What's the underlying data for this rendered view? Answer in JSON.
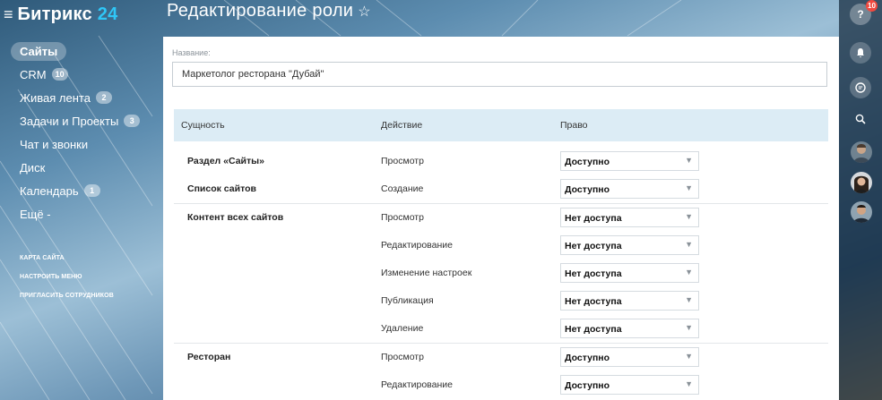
{
  "app": {
    "logo_main": "Битрикс",
    "logo_num": "24"
  },
  "sidebar": {
    "items": [
      {
        "label": "Сайты",
        "badge": ""
      },
      {
        "label": "CRM",
        "badge": "10"
      },
      {
        "label": "Живая лента",
        "badge": "2"
      },
      {
        "label": "Задачи и Проекты",
        "badge": "3"
      },
      {
        "label": "Чат и звонки",
        "badge": ""
      },
      {
        "label": "Диск",
        "badge": ""
      },
      {
        "label": "Календарь",
        "badge": "1"
      },
      {
        "label": "Ещё -",
        "badge": ""
      }
    ],
    "links": [
      "КАРТА САЙТА",
      "НАСТРОИТЬ МЕНЮ",
      "ПРИГЛАСИТЬ СОТРУДНИКОВ"
    ]
  },
  "header": {
    "title": "Редактирование роли",
    "star": "☆"
  },
  "form": {
    "name_label": "Название:",
    "name_value": "Маркетолог ресторана \"Дубай\""
  },
  "table": {
    "headers": {
      "entity": "Сущность",
      "action": "Действие",
      "right": "Право"
    },
    "rows": [
      {
        "entity": "Раздел «Сайты»",
        "action": "Просмотр",
        "right": "Доступно"
      },
      {
        "entity": "Список сайтов",
        "action": "Создание",
        "right": "Доступно"
      },
      {
        "entity": "Контент всех сайтов",
        "action": "Просмотр",
        "right": "Нет доступа"
      },
      {
        "entity": "",
        "action": "Редактирование",
        "right": "Нет доступа"
      },
      {
        "entity": "",
        "action": "Изменение настроек",
        "right": "Нет доступа"
      },
      {
        "entity": "",
        "action": "Публикация",
        "right": "Нет доступа"
      },
      {
        "entity": "",
        "action": "Удаление",
        "right": "Нет доступа"
      },
      {
        "entity": "Ресторан",
        "action": "Просмотр",
        "right": "Доступно"
      },
      {
        "entity": "",
        "action": "Редактирование",
        "right": "Доступно"
      }
    ]
  },
  "rail": {
    "help_label": "?",
    "help_badge": "10",
    "icons": [
      "bell-icon",
      "chat-icon",
      "search-icon"
    ]
  },
  "colors": {
    "accent": "#2fc6f6",
    "header_row": "#dcecf5",
    "badge_red": "#f0493f"
  }
}
